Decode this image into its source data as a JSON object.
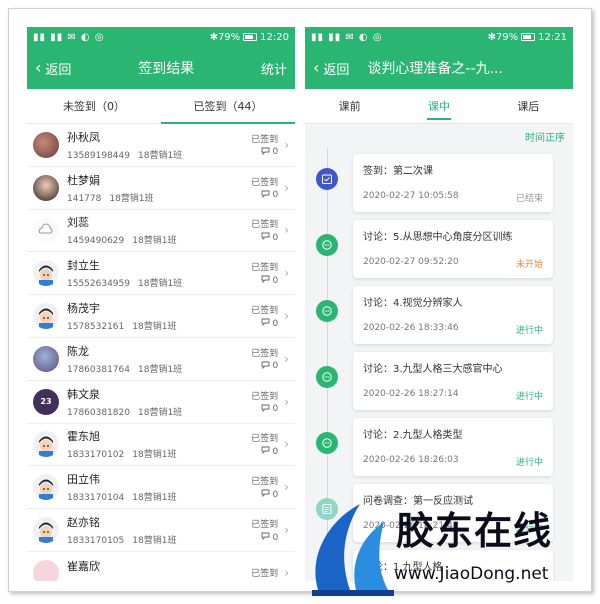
{
  "colors": {
    "brand": "#2bb573",
    "pending": "#f08a3c",
    "ended": "#999999"
  },
  "left": {
    "statusbar": {
      "left": "▮▮ ▮▮ ✉ ◐ ◎",
      "right": "✱79%",
      "time": "12:20"
    },
    "title": "签到结果",
    "back_label": "返回",
    "stats_label": "统计",
    "tabs": [
      {
        "label": "未签到（0）"
      },
      {
        "label": "已签到（44）"
      }
    ],
    "rows": [
      {
        "name": "孙秋凤",
        "phone": "13589198449",
        "class": "18营销1班",
        "status": "已签到",
        "comments": "0",
        "avatar": "photo-1"
      },
      {
        "name": "杜梦娟",
        "phone": "141778",
        "class": "18营销1班",
        "status": "已签到",
        "comments": "0",
        "avatar": "photo-2"
      },
      {
        "name": "刘蕊",
        "phone": "1459490629",
        "class": "18营销1班",
        "status": "已签到",
        "comments": "0",
        "avatar": "cloud"
      },
      {
        "name": "封立生",
        "phone": "15552634959",
        "class": "18营销1班",
        "status": "已签到",
        "comments": "0",
        "avatar": "cartoon"
      },
      {
        "name": "杨茂宇",
        "phone": "1578532161",
        "class": "18营销1班",
        "status": "已签到",
        "comments": "0",
        "avatar": "cartoon"
      },
      {
        "name": "陈龙",
        "phone": "17860381764",
        "class": "18营销1班",
        "status": "已签到",
        "comments": "0",
        "avatar": "photo-3"
      },
      {
        "name": "韩文泉",
        "phone": "17860381820",
        "class": "18营销1班",
        "status": "已签到",
        "comments": "0",
        "avatar": "purple"
      },
      {
        "name": "霍东旭",
        "phone": "1833170102",
        "class": "18营销1班",
        "status": "已签到",
        "comments": "0",
        "avatar": "cartoon"
      },
      {
        "name": "田立伟",
        "phone": "1833170104",
        "class": "18营销1班",
        "status": "已签到",
        "comments": "0",
        "avatar": "cartoon"
      },
      {
        "name": "赵亦铭",
        "phone": "1833170105",
        "class": "18营销1班",
        "status": "已签到",
        "comments": "0",
        "avatar": "cartoon"
      },
      {
        "name": "崔嘉欣",
        "phone": "",
        "class": "",
        "status": "已签到",
        "comments": "",
        "avatar": "pink"
      }
    ]
  },
  "right": {
    "statusbar": {
      "left": "▮▮ ▮▮ ✉ ◐ ◎",
      "right": "✱79%",
      "time": "12:21"
    },
    "title": "谈判心理准备之--九...",
    "back_label": "返回",
    "tabs": [
      {
        "label": "课前"
      },
      {
        "label": "课中"
      },
      {
        "label": "课后"
      }
    ],
    "order_label": "时间正序",
    "items": [
      {
        "title": "签到：第二次课",
        "time": "2020-02-27 10:05:58",
        "status": "已结束",
        "status_type": "ended",
        "icon": "signin"
      },
      {
        "title": "讨论：5.从思想中心角度分区训练",
        "time": "2020-02-27 09:52:20",
        "status": "未开始",
        "status_type": "pending",
        "icon": "chat"
      },
      {
        "title": "讨论：4.视觉分辨家人",
        "time": "2020-02-26 18:33:46",
        "status": "进行中",
        "status_type": "running",
        "icon": "chat"
      },
      {
        "title": "讨论：3.九型人格三大感官中心",
        "time": "2020-02-26 18:27:14",
        "status": "进行中",
        "status_type": "running",
        "icon": "chat"
      },
      {
        "title": "讨论：2.九型人格类型",
        "time": "2020-02-26 18:26:03",
        "status": "进行中",
        "status_type": "running",
        "icon": "chat"
      },
      {
        "title": "问卷调查：第一反应测试",
        "time": "2020-02-26 18:21:47",
        "status": "进行中",
        "status_type": "running",
        "icon": "survey"
      },
      {
        "title": "讨论：1.九型人格",
        "time": "",
        "status": "",
        "status_type": "running",
        "icon": "chat"
      }
    ]
  },
  "watermark": {
    "text": "胶东在线",
    "url": "www.JiaoDong.net"
  }
}
